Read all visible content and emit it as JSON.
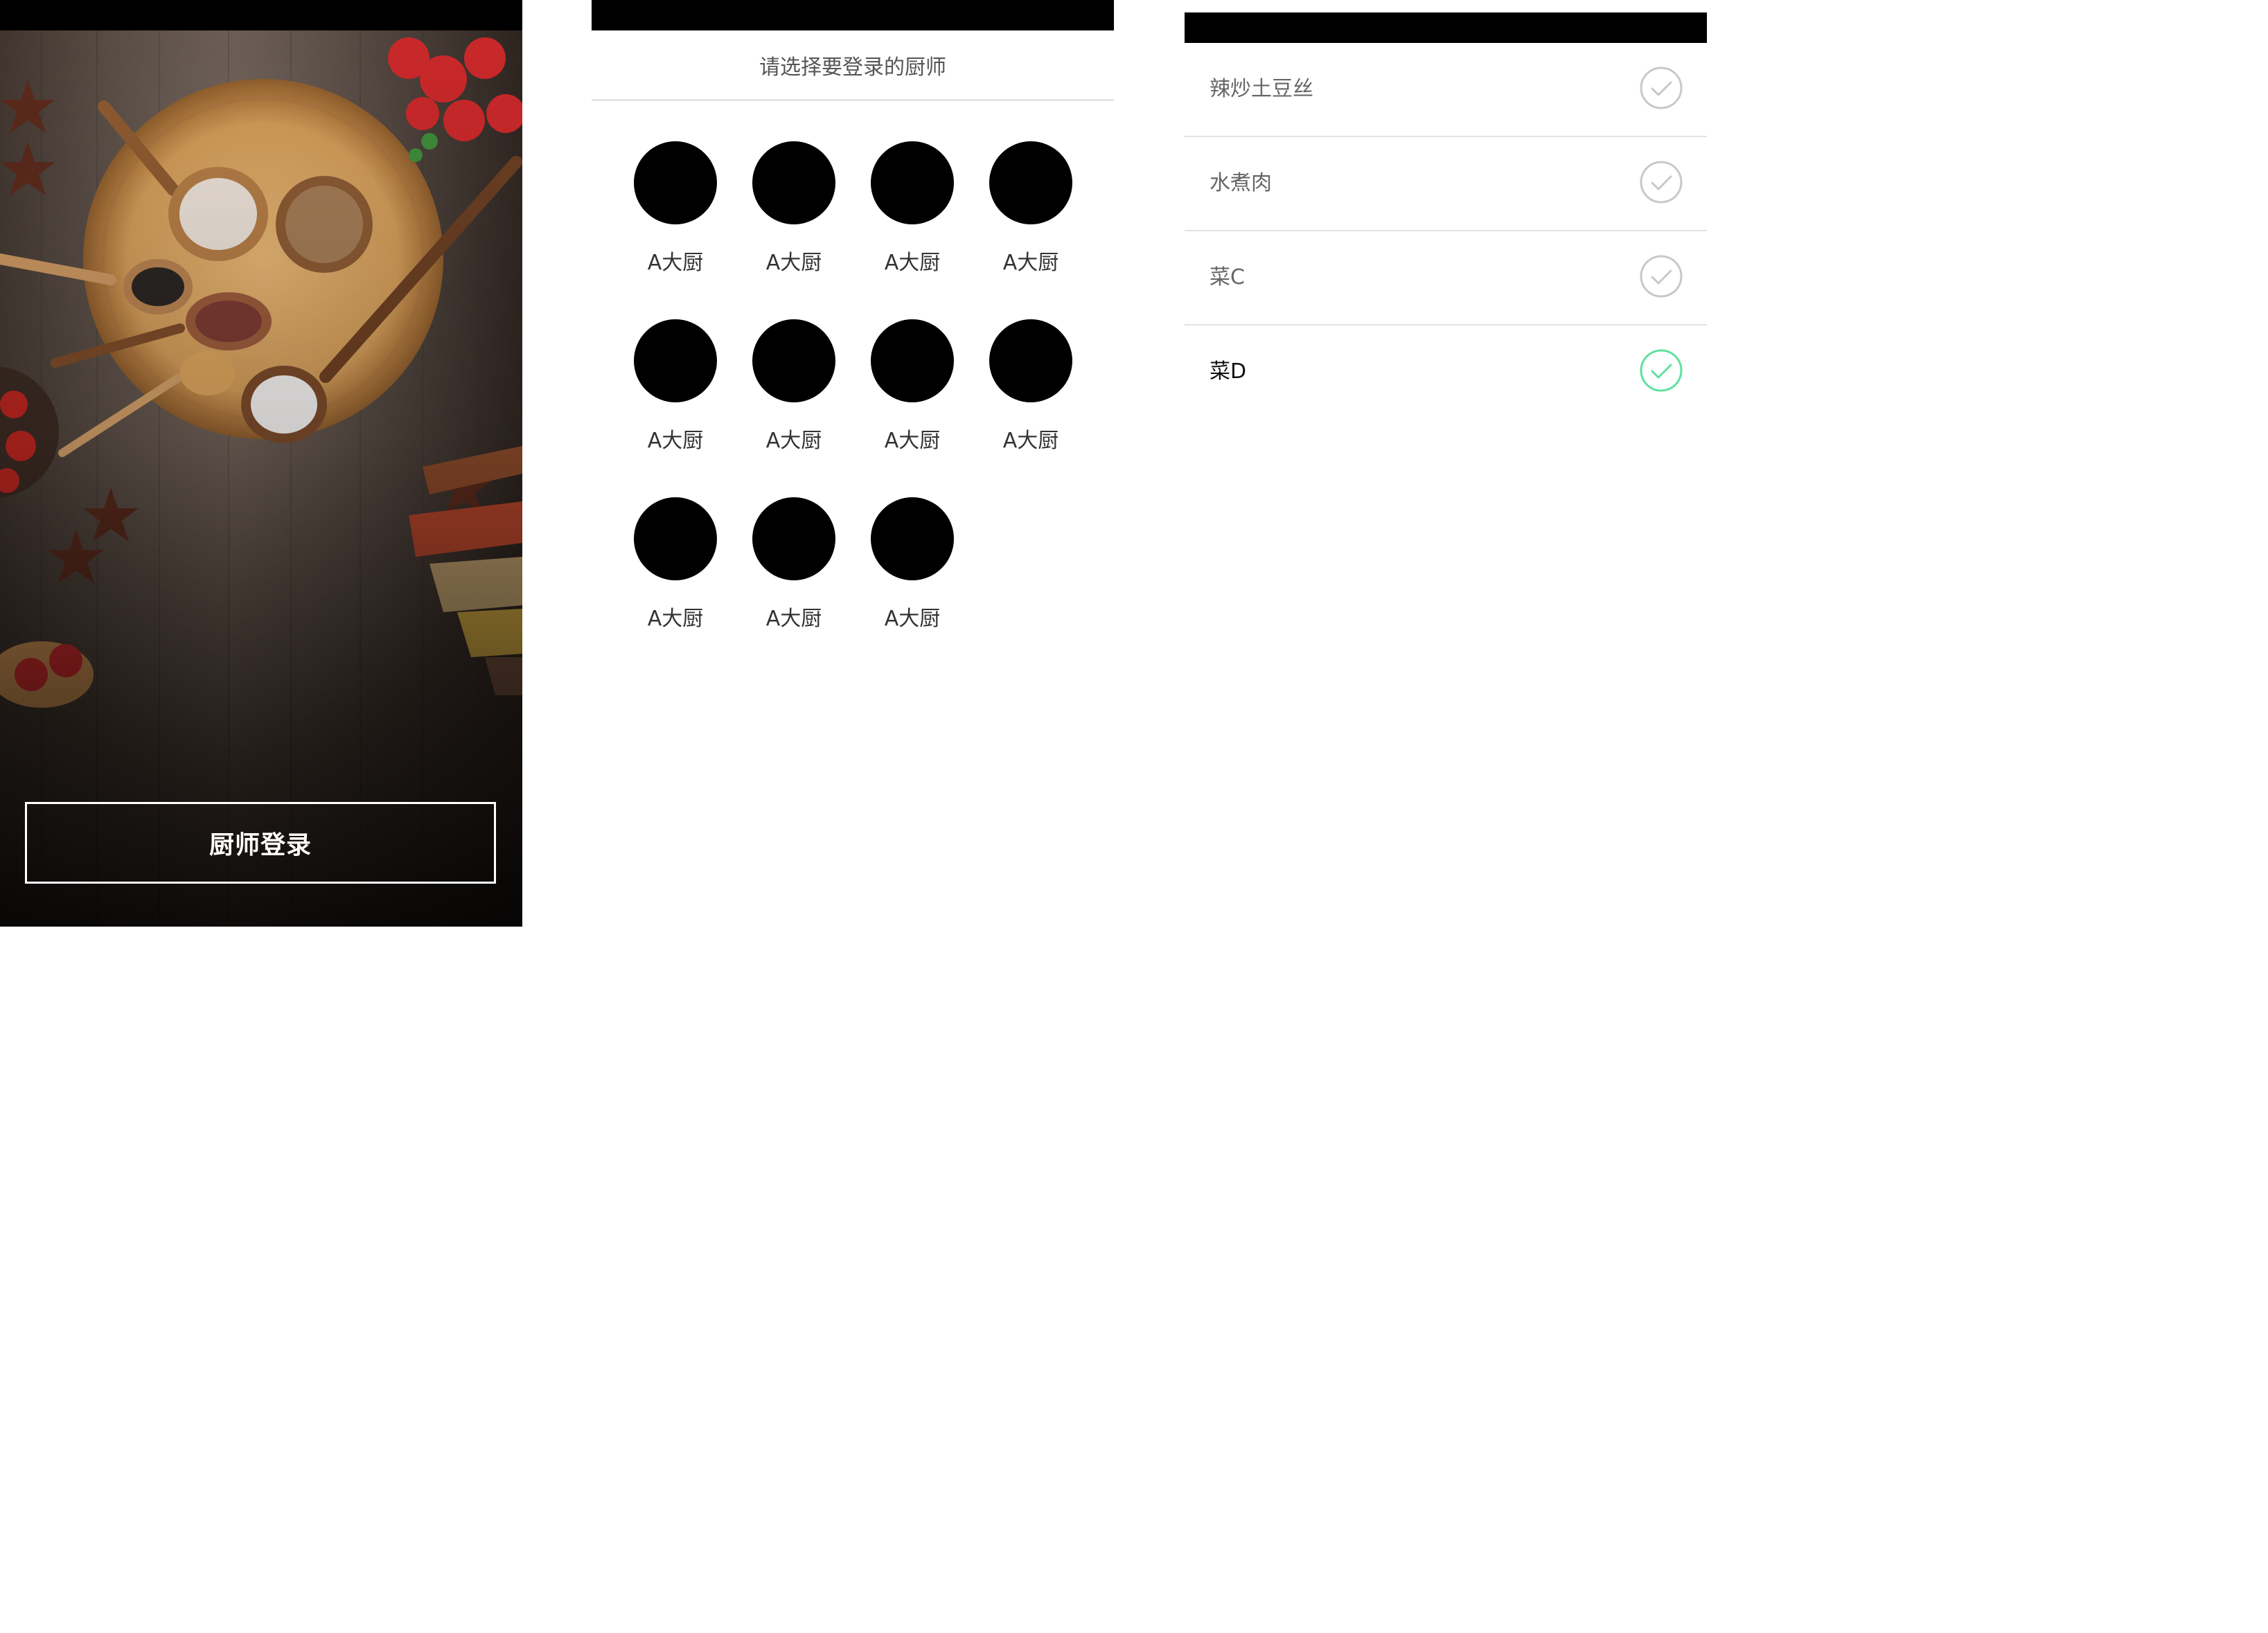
{
  "login_screen": {
    "button_label": "厨师登录"
  },
  "chef_screen": {
    "header_title": "请选择要登录的厨师",
    "chefs": [
      {
        "name": "A大厨"
      },
      {
        "name": "A大厨"
      },
      {
        "name": "A大厨"
      },
      {
        "name": "A大厨"
      },
      {
        "name": "A大厨"
      },
      {
        "name": "A大厨"
      },
      {
        "name": "A大厨"
      },
      {
        "name": "A大厨"
      },
      {
        "name": "A大厨"
      },
      {
        "name": "A大厨"
      },
      {
        "name": "A大厨"
      }
    ]
  },
  "dish_screen": {
    "dishes": [
      {
        "name": "辣炒土豆丝",
        "selected": false
      },
      {
        "name": "水煮肉",
        "selected": false
      },
      {
        "name": "菜C",
        "selected": false
      },
      {
        "name": "菜D",
        "selected": true
      }
    ]
  },
  "colors": {
    "check_selected": "#5fe0a0",
    "check_unselected": "#c8c8c8"
  },
  "icons": {
    "check": "check-circle-icon"
  }
}
